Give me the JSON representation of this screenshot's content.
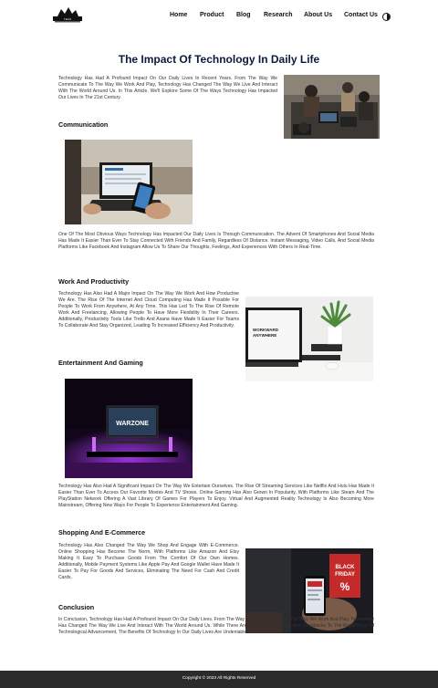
{
  "header": {
    "logo_alt": "logo",
    "nav": [
      {
        "label": "Home"
      },
      {
        "label": "Product"
      },
      {
        "label": "Blog"
      },
      {
        "label": "Research"
      },
      {
        "label": "About Us"
      },
      {
        "label": "Contact Us"
      }
    ],
    "theme_icon": "half-circle-contrast-icon"
  },
  "article": {
    "title": "The Impact Of Technology In Daily Life",
    "intro": "Technology Has Had A Profound Impact On Our Daily Lives In Recent Years. From The Way We Communicate To The Way We Work And Play, Technology Has Changed The Way We Live And Interact With The World Around Us. In This Article, We'll Explore Some Of The Ways Technology Has Impacted Our Lives In The 21st Century.",
    "sections": [
      {
        "heading": "Communication",
        "body": "One Of The Most Obvious Ways Technology Has Impacted Our Daily Lives Is Through Communication. The Advent Of Smartphones And Social Media Has Made It Easier Than Ever To Stay Connected With Friends And Family, Regardless Of Distance. Instant Messaging, Video Calls, And Social Media Platforms Like Facebook And Instagram Allow Us To Share Our Thoughts, Feelings, And Experiences With Others In Real-Time."
      },
      {
        "heading": "Work And Productivity",
        "body": "Technology Has Also Had A Major Impact On The Way We Work And How Productive We Are. The Rise Of The Internet And Cloud Computing Has Made It Possible For People To Work From Anywhere, At Any Time. This Has Led To The Rise Of Remote Work And Freelancing, Allowing People To Have More Flexibility In Their Careers. Additionally, Productivity Tools Like Trello And Asana Have Made It Easier For Teams To Collaborate And Stay Organized, Leading To Increased Efficiency And Productivity."
      },
      {
        "heading": "Entertainment And Gaming",
        "body": "Technology Has Also Had A Significant Impact On The Way We Entertain Ourselves. The Rise Of Streaming Services Like Netflix And Hulu Has Made It Easier Than Ever To Access Our Favorite Movies And TV Shows. Online Gaming Has Also Grown In Popularity, With Platforms Like Steam And The PlayStation Network Offering A Vast Library Of Games For Players To Enjoy. Virtual And Augmented Reality Technology Is Also Becoming More Mainstream, Offering New Ways For People To Experience Entertainment And Gaming."
      },
      {
        "heading": "Shopping And E-Commerce",
        "body": "Technology Has Also Changed The Way We Shop And Engage With E-Commerce. Online Shopping Has Become The Norm, With Platforms Like Amazon And Etsy Making It Easy To Purchase Goods From The Comfort Of Our Own Homes. Additionally, Mobile Payment Systems Like Apple Pay And Google Wallet Have Made It Easier To Pay For Goods And Services, Eliminating The Need For Cash And Credit Cards."
      },
      {
        "heading": "Conclusion",
        "body": "In Conclusion, Technology Has Had A Profound Impact On Our Daily Lives. From The Way We Communicate To The Way We Work And Play, Technology Has Changed The Way We Live And Interact With The World Around Us. While There Are Certainly Challenges And Drawbacks To The Rapid Pace Of Technological Advancement, The Benefits Of Technology In Our Daily Lives Are Undeniable."
      }
    ],
    "game_screen_text": "WARZONE",
    "phone_sign_text": "BLACK FRIDAY",
    "phone_sign_percent": "%"
  },
  "footer": {
    "copyright": "Copyright © 2023 All Rights Reserved"
  },
  "colors": {
    "title": "#0b1a3a",
    "footer_bg": "#2b2b2b",
    "gaming_glow": "#b23bff"
  }
}
